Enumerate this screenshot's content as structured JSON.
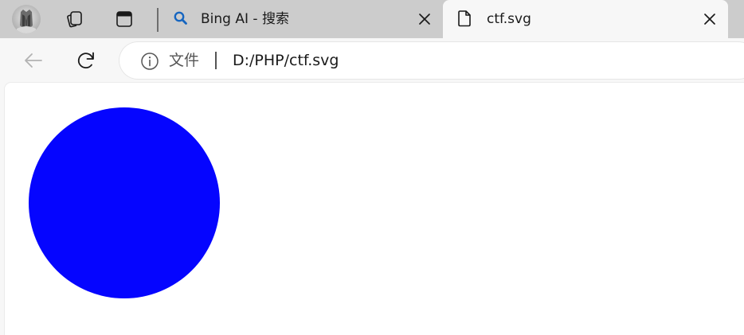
{
  "tabs": [
    {
      "title": "Bing AI - 搜索",
      "icon": "search-icon",
      "active": false
    },
    {
      "title": "ctf.svg",
      "icon": "file-icon",
      "active": true
    }
  ],
  "address_bar": {
    "scheme_label": "文件",
    "url": "D:/PHP/ctf.svg"
  },
  "document": {
    "shape": "circle",
    "fill_color": "#0505ff"
  },
  "colors": {
    "tabstrip_bg": "#cccccc",
    "toolbar_bg": "#f7f7f7",
    "bing_icon": "#1565c0"
  }
}
